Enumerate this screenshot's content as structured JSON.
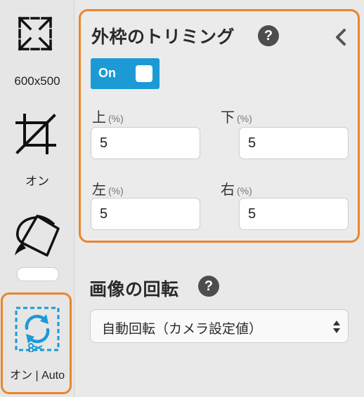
{
  "sidebar": {
    "size_label": "600x500",
    "crop_label": "オン",
    "rotate_label": "オン | Auto",
    "icons": [
      "expand-icon",
      "crop-icon",
      "paint-bucket-icon",
      "auto-rotate-icon"
    ]
  },
  "trim_panel": {
    "title": "外枠のトリミング",
    "help": "?",
    "toggle_label": "On",
    "fields": [
      {
        "label": "上",
        "unit": "(%)",
        "value": "5"
      },
      {
        "label": "下",
        "unit": "(%)",
        "value": "5"
      },
      {
        "label": "左",
        "unit": "(%)",
        "value": "5"
      },
      {
        "label": "右",
        "unit": "(%)",
        "value": "5"
      }
    ]
  },
  "rotation": {
    "title": "画像の回転",
    "help": "?",
    "selected": "自動回転（カメラ設定値）"
  },
  "colors": {
    "accent_orange": "#e8862c",
    "toggle_blue": "#1b9ad6",
    "icon_blue": "#1b9ad6"
  }
}
